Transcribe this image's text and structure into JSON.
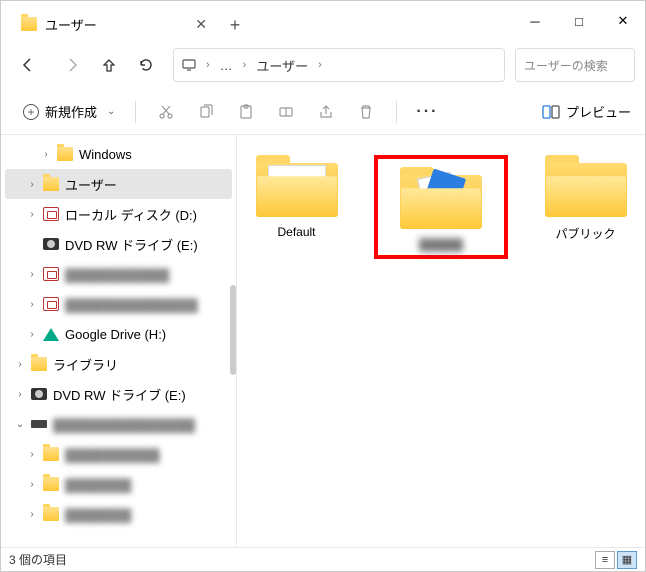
{
  "titlebar": {
    "tab_title": "ユーザー"
  },
  "nav": {
    "breadcrumb_current": "ユーザー",
    "search_placeholder": "ユーザーの検索"
  },
  "toolbar": {
    "new_label": "新規作成",
    "preview_label": "プレビュー"
  },
  "sidebar": {
    "items": [
      {
        "arrow": "›",
        "icon": "folder",
        "label": "Windows",
        "level": 2
      },
      {
        "arrow": "›",
        "icon": "folder",
        "label": "ユーザー",
        "level": 2,
        "selected": true
      },
      {
        "arrow": "›",
        "icon": "drive",
        "label": "ローカル ディスク (D:)",
        "level": 1
      },
      {
        "arrow": "",
        "icon": "dvd",
        "label": "DVD RW ドライブ (E:)",
        "level": 1
      },
      {
        "arrow": "›",
        "icon": "drive",
        "label": "▓▓▓▓▓▓▓▓▓▓▓",
        "level": 1,
        "blur": true
      },
      {
        "arrow": "›",
        "icon": "drive",
        "label": "▓▓▓▓▓▓▓▓▓▓▓▓▓▓",
        "level": 1,
        "blur": true
      },
      {
        "arrow": "›",
        "icon": "gdrive",
        "label": "Google Drive (H:)",
        "level": 1
      },
      {
        "arrow": "›",
        "icon": "folder",
        "label": "ライブラリ",
        "level": 0
      },
      {
        "arrow": "›",
        "icon": "dvd",
        "label": "DVD RW ドライブ (E:)",
        "level": 0
      },
      {
        "arrow": "⌄",
        "icon": "ssd",
        "label": "▓▓▓▓▓▓▓▓▓▓▓▓▓▓▓",
        "level": 0,
        "blur": true
      },
      {
        "arrow": "›",
        "icon": "folder",
        "label": "▓▓▓▓▓▓▓▓▓▓",
        "level": 1,
        "blur": true
      },
      {
        "arrow": "›",
        "icon": "folder",
        "label": "▓▓▓▓▓▓▓",
        "level": 1,
        "blur": true
      },
      {
        "arrow": "›",
        "icon": "folder",
        "label": "▓▓▓▓▓▓▓",
        "level": 1,
        "blur": true
      }
    ]
  },
  "content": {
    "items": [
      {
        "label": "Default",
        "variant": "plain-paper"
      },
      {
        "label": "▓▓▓▓▓",
        "variant": "docs",
        "highlighted": true,
        "blur_label": true
      },
      {
        "label": "パブリック",
        "variant": "empty"
      }
    ]
  },
  "status": {
    "text": "3 個の項目"
  }
}
